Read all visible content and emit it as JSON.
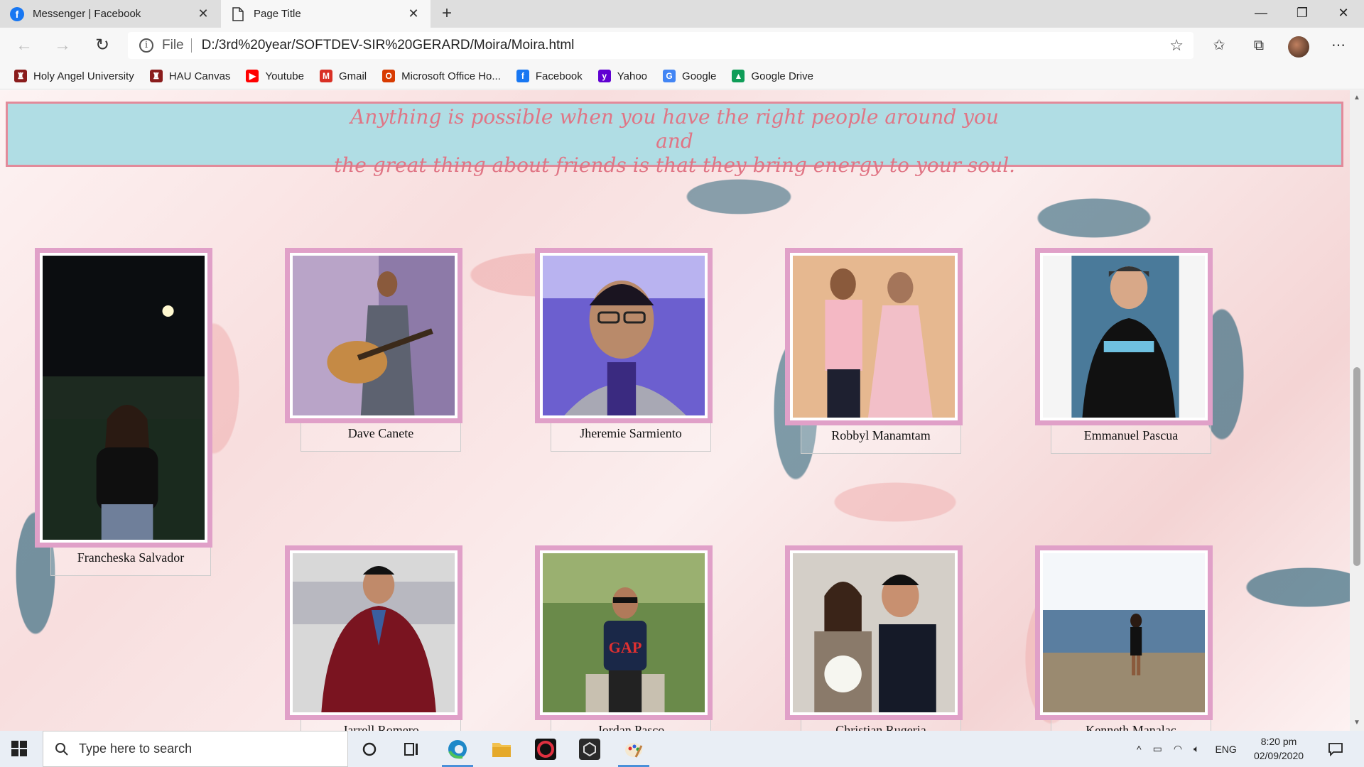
{
  "browser": {
    "tabs": [
      {
        "title": "Messenger | Facebook",
        "icon": "facebook-icon",
        "active": false
      },
      {
        "title": "Page Title",
        "icon": "page-icon",
        "active": true
      }
    ],
    "address": {
      "scheme_label": "File",
      "url": "D:/3rd%20year/SOFTDEV-SIR%20GERARD/Moira/Moira.html"
    },
    "bookmarks": [
      {
        "label": "Holy Angel University",
        "icon": "hau-crest-icon",
        "color": "#8a1c1c"
      },
      {
        "label": "HAU Canvas",
        "icon": "hau-crest-icon",
        "color": "#8a1c1c"
      },
      {
        "label": "Youtube",
        "icon": "youtube-icon",
        "color": "#ff0000"
      },
      {
        "label": "Gmail",
        "icon": "gmail-icon",
        "color": "#d93025"
      },
      {
        "label": "Microsoft Office Ho...",
        "icon": "office-icon",
        "color": "#d83b01"
      },
      {
        "label": "Facebook",
        "icon": "facebook-icon",
        "color": "#1877f2"
      },
      {
        "label": "Yahoo",
        "icon": "yahoo-icon",
        "color": "#6001d2"
      },
      {
        "label": "Google",
        "icon": "google-icon",
        "color": "#4285f4"
      },
      {
        "label": "Google Drive",
        "icon": "google-drive-icon",
        "color": "#0f9d58"
      }
    ]
  },
  "page": {
    "quote": {
      "line1": "Anything is possible when you have the right people around you",
      "line2": "and",
      "line3": "the great thing about friends is that they bring energy to your soul."
    },
    "colors": {
      "quote_bg": "#b0dde4",
      "quote_text": "#e07585",
      "frame": "#e0a0c8"
    },
    "people": [
      {
        "name": "Francheska Salvador"
      },
      {
        "name": "Dave Canete"
      },
      {
        "name": "Jheremie Sarmiento"
      },
      {
        "name": "Robbyl Manamtam"
      },
      {
        "name": "Emmanuel Pascua"
      },
      {
        "name": "Jarrell Romero"
      },
      {
        "name": "Jordan Pasco"
      },
      {
        "name": "Christian Rugeria"
      },
      {
        "name": "Kenneth Manalac"
      }
    ]
  },
  "taskbar": {
    "search_placeholder": "Type here to search",
    "language": "ENG",
    "time": "8:20 pm",
    "date": "02/09/2020"
  }
}
